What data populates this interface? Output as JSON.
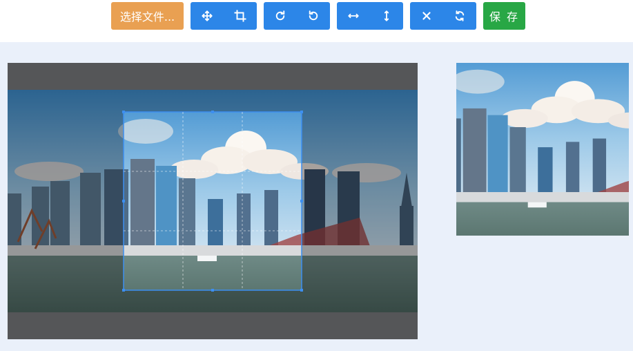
{
  "toolbar": {
    "choose_file_label": "选择文件...",
    "save_label": "保 存",
    "groups": [
      {
        "name": "move-crop",
        "icons": [
          "move-icon",
          "crop-icon"
        ]
      },
      {
        "name": "rotate",
        "icons": [
          "rotate-right-icon",
          "rotate-left-icon"
        ]
      },
      {
        "name": "flip",
        "icons": [
          "flip-horizontal-icon",
          "flip-vertical-icon"
        ]
      },
      {
        "name": "reset",
        "icons": [
          "close-icon",
          "refresh-icon"
        ]
      }
    ]
  },
  "colors": {
    "primary": "#2c86e8",
    "choose_button": "#e9a052",
    "save_button": "#28a745",
    "workspace_background": "#eaf0fa",
    "crop_outline": "#3d8ff0"
  }
}
